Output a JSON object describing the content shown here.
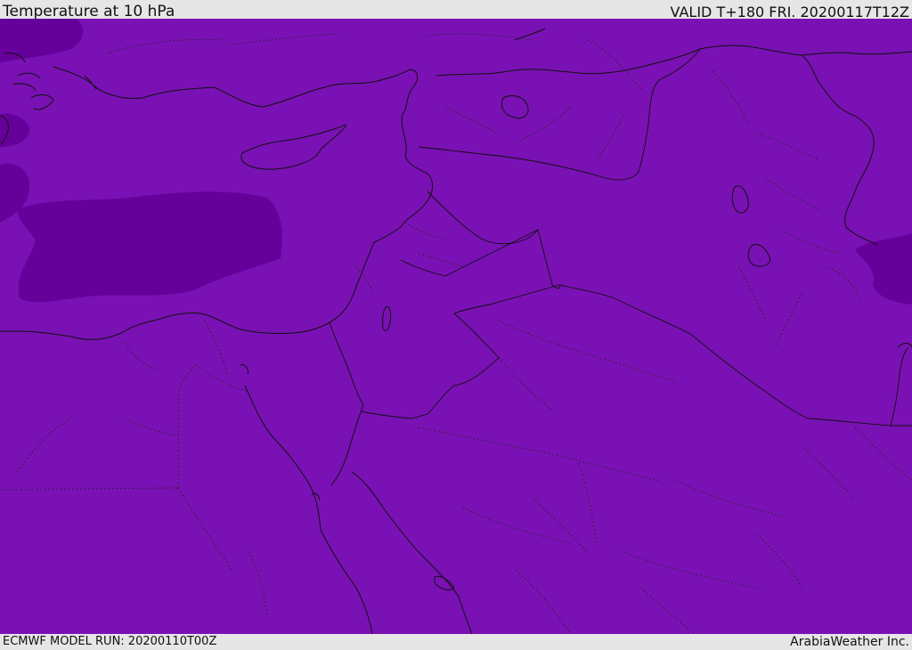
{
  "header": {
    "title": "Temperature at 10 hPa",
    "valid": "VALID T+180 FRI. 20200117T12Z"
  },
  "footer": {
    "model_run": "ECMWF MODEL RUN: 20200110T00Z",
    "credit": "ArabiaWeather Inc."
  },
  "colors": {
    "field_main": "#7a11b4",
    "field_cold": "#66009a",
    "coastline": "#111111",
    "bar_background": "#e6e6e6"
  }
}
